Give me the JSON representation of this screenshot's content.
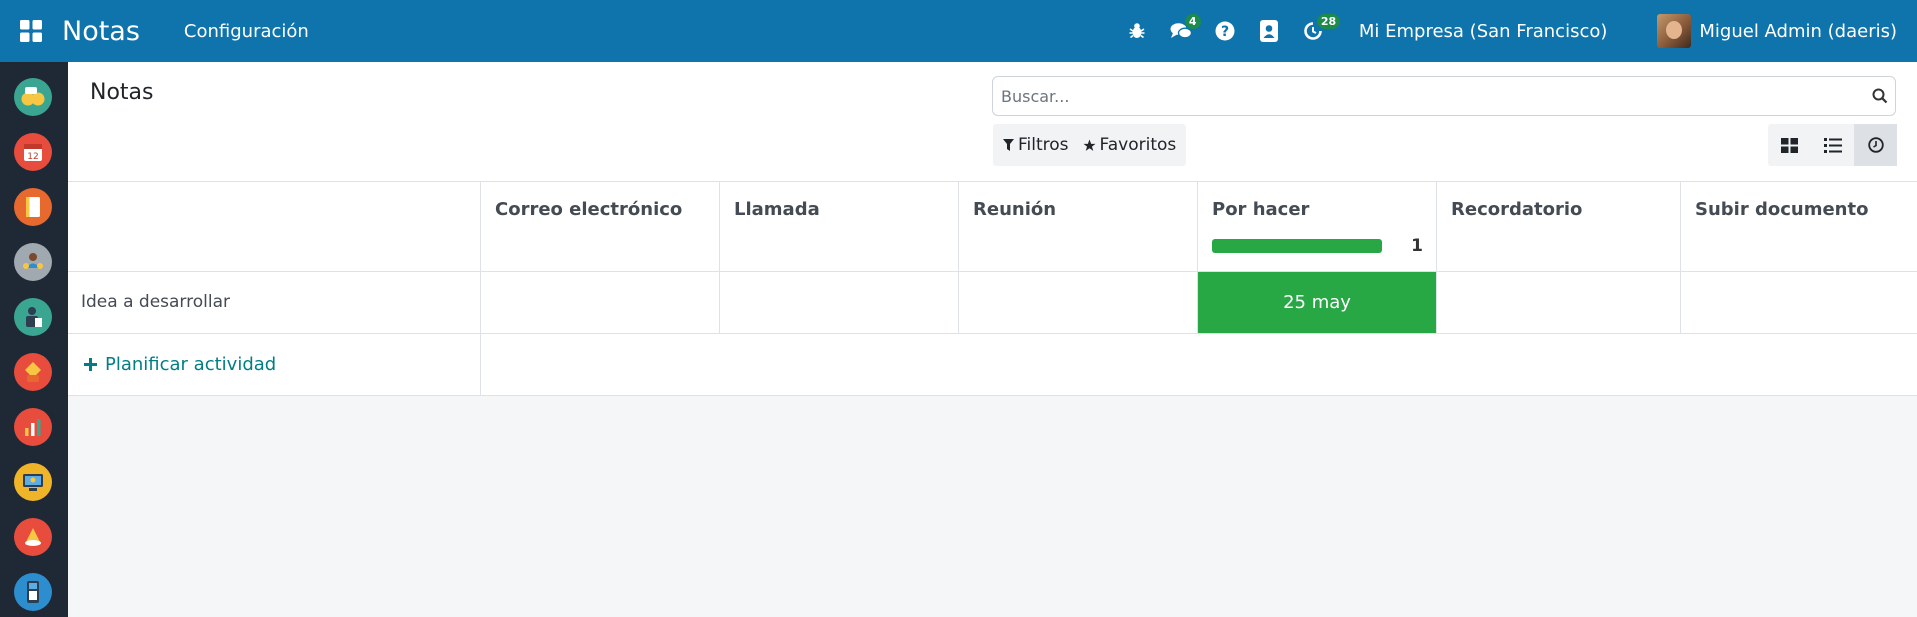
{
  "navbar": {
    "app_title": "Notas",
    "menu_config": "Configuración",
    "chat_badge": "4",
    "activity_badge": "28",
    "company": "Mi Empresa (San Francisco)",
    "user_name": "Miguel Admin (daeris)"
  },
  "sidebar": {
    "apps": [
      {
        "icon": "discuss-icon",
        "color": "#3aa691"
      },
      {
        "icon": "calendar-icon",
        "color": "#e74c3c"
      },
      {
        "icon": "notes-icon",
        "color": "#e8692d"
      },
      {
        "icon": "contacts-icon",
        "color": "#a0a8b0"
      },
      {
        "icon": "crm-icon",
        "color": "#3aa691"
      },
      {
        "icon": "sales-icon",
        "color": "#e74c3c"
      },
      {
        "icon": "dashboards-icon",
        "color": "#e74c3c"
      },
      {
        "icon": "website-icon",
        "color": "#f0b429"
      },
      {
        "icon": "expenses-icon",
        "color": "#e74c3c"
      },
      {
        "icon": "pos-icon",
        "color": "#2d8ecf"
      }
    ]
  },
  "control_panel": {
    "title": "Notas",
    "search_placeholder": "Buscar...",
    "filters_label": "Filtros",
    "favorites_label": "Favoritos"
  },
  "views": [
    "kanban",
    "list",
    "activity"
  ],
  "active_view": "activity",
  "grid": {
    "columns": [
      {
        "label": "Correo electrónico"
      },
      {
        "label": "Llamada"
      },
      {
        "label": "Reunión"
      },
      {
        "label": "Por hacer",
        "progress": 1.0,
        "count": "1"
      },
      {
        "label": "Recordatorio"
      },
      {
        "label": "Subir documento"
      }
    ],
    "rows": [
      {
        "name": "Idea a desarrollar",
        "cells": [
          "",
          "",
          "",
          "25 may",
          "",
          ""
        ]
      }
    ],
    "add_label": "Planificar actividad"
  },
  "colors": {
    "navbar": "#0f73ac",
    "sidebar": "#1f2936",
    "todo_green": "#28a745",
    "link_teal": "#017e84"
  }
}
